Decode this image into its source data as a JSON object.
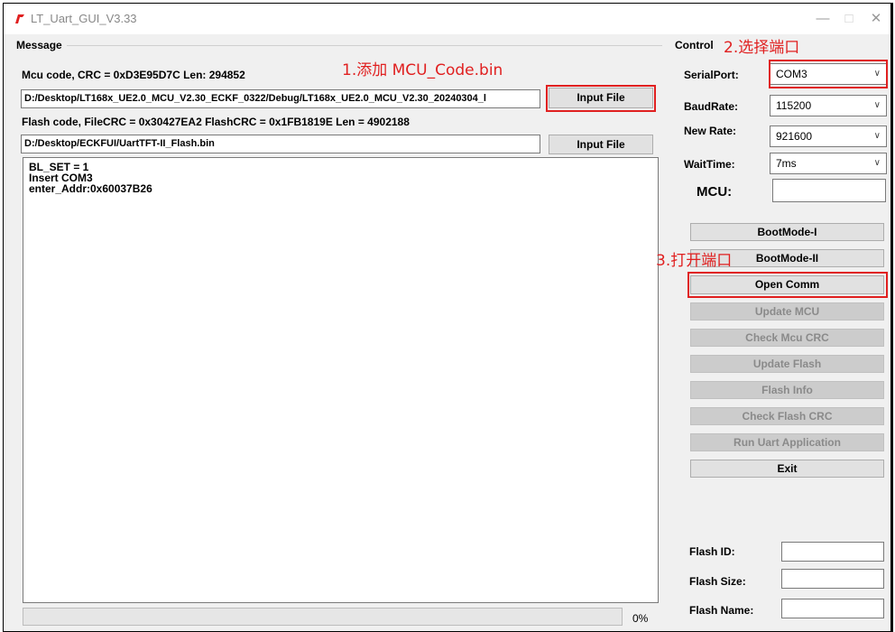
{
  "window": {
    "title": "LT_Uart_GUI_V3.33",
    "min": "—",
    "max": "□",
    "close": "✕"
  },
  "message": {
    "group_label": "Message",
    "mcu_info": "Mcu code, CRC = 0xD3E95D7C Len: 294852",
    "mcu_path": "D:/Desktop/LT168x_UE2.0_MCU_V2.30_ECKF_0322/Debug/LT168x_UE2.0_MCU_V2.30_20240304_l",
    "mcu_button": "Input File",
    "flash_info": "Flash code, FileCRC = 0x30427EA2  FlashCRC = 0x1FB1819E  Len = 4902188",
    "flash_path": "D:/Desktop/ECKFUI/UartTFT-II_Flash.bin",
    "flash_button": "Input File",
    "log": [
      "BL_SET = 1",
      "Insert COM3",
      "enter_Addr:0x60037B26"
    ],
    "progress_pct": "0%",
    "progress_value": 0
  },
  "control": {
    "group_label": "Control",
    "serial_label": "SerialPort:",
    "serial_value": "COM3",
    "baud_label": "BaudRate:",
    "baud_value": "115200",
    "newrate_label": "New Rate:",
    "newrate_value": "921600",
    "wait_label": "WaitTime:",
    "wait_value": "7ms",
    "mcu_label": "MCU:",
    "buttons": {
      "bootmode1": "BootMode-I",
      "bootmode2": "BootMode-II",
      "open": "Open Comm",
      "update_mcu": "Update MCU",
      "check_mcu": "Check Mcu CRC",
      "update_flash": "Update Flash",
      "flash_info": "Flash Info",
      "check_flash": "Check Flash CRC",
      "run": "Run Uart Application",
      "exit": "Exit"
    },
    "flash_id_label": "Flash ID:",
    "flash_size_label": "Flash Size:",
    "flash_name_label": "Flash Name:"
  },
  "annotations": {
    "a1": "1.添加 MCU_Code.bin",
    "a2": "2.选择端口",
    "a3": "3.打开端口"
  },
  "colors": {
    "annotation": "#e02020",
    "icon": "#e02020"
  }
}
